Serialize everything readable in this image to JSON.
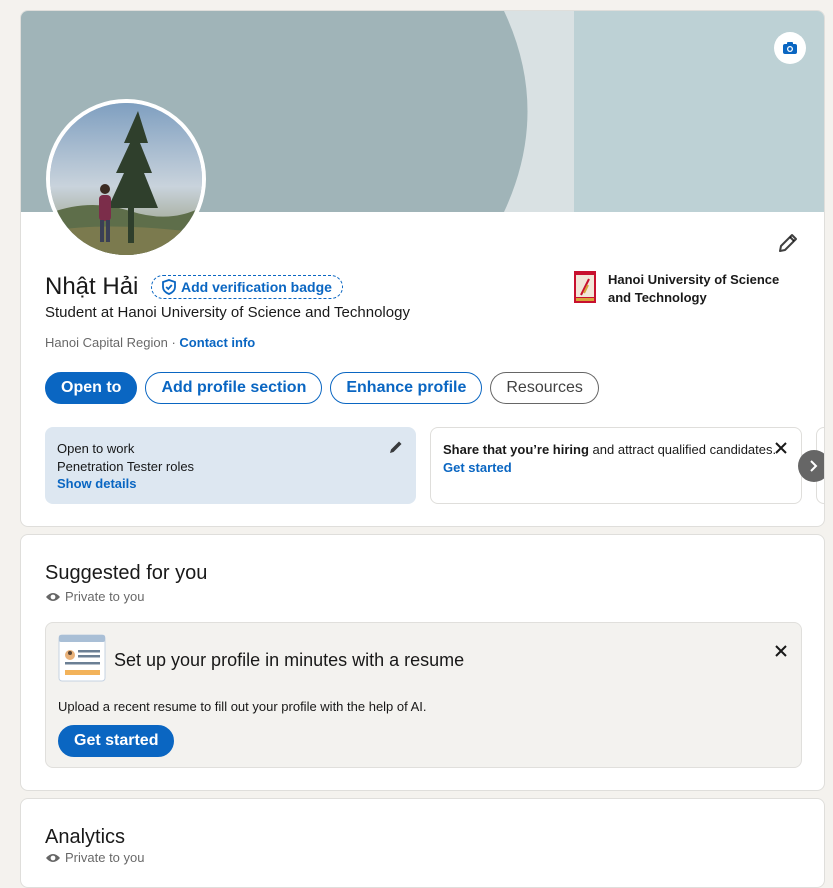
{
  "profile": {
    "name": "Nhật Hải",
    "verification_badge": "Add verification badge",
    "headline": "Student at Hanoi University of Science and Technology",
    "location": "Hanoi Capital Region",
    "separator": " · ",
    "contact_info": "Contact info",
    "school": "Hanoi University of Science and Technology",
    "buttons": {
      "open_to": "Open to",
      "add_section": "Add profile section",
      "enhance": "Enhance profile",
      "resources": "Resources"
    },
    "open_to_work": {
      "title": "Open to work",
      "subtitle": "Penetration Tester roles",
      "link": "Show details"
    },
    "hiring": {
      "bold": "Share that you’re hiring",
      "rest": " and attract qualified candidates.",
      "link": "Get started"
    },
    "colors": {
      "accent": "#0a66c2",
      "open_card_bg": "#dde7f1",
      "cover_left": "#a0b4b8",
      "cover_right": "#bdd1d5"
    }
  },
  "suggested": {
    "title": "Suggested for you",
    "privacy": "Private to you",
    "resume_title": "Set up your profile in minutes with a resume",
    "resume_desc": "Upload a recent resume to fill out your profile with the help of AI.",
    "resume_button": "Get started"
  },
  "analytics": {
    "title": "Analytics",
    "privacy": "Private to you"
  },
  "icons": {
    "camera": "camera-icon",
    "pencil": "pencil-icon",
    "shield": "shield-check-icon",
    "eye": "eye-icon",
    "close": "close-icon",
    "chevron": "chevron-right-icon"
  }
}
